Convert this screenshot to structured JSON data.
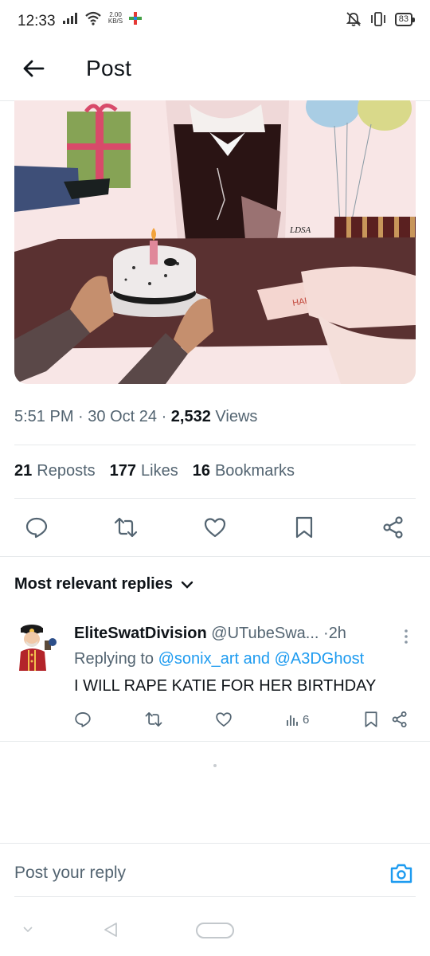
{
  "status_bar": {
    "time": "12:33",
    "speed_value": "2.00",
    "speed_unit": "KB/S",
    "battery": "83"
  },
  "header": {
    "title": "Post"
  },
  "post": {
    "image_signature": "LDSA",
    "card_text": "HAPPY BIRTHDAY",
    "time": "5:51 PM",
    "date": "30 Oct 24",
    "views_count": "2,532",
    "views_label": "Views",
    "reposts_count": "21",
    "reposts_label": "Reposts",
    "likes_count": "177",
    "likes_label": "Likes",
    "bookmarks_count": "16",
    "bookmarks_label": "Bookmarks"
  },
  "replies_section": {
    "label": "Most relevant replies"
  },
  "reply": {
    "display_name": "EliteSwatDivision",
    "handle": "@UTubeSwa...",
    "age": "2h",
    "replying_to_label": "Replying to",
    "mention_1": "@sonix_art",
    "and_label": "and",
    "mention_2": "@A3DGhost",
    "text": "I WILL RAPE KATIE FOR HER BIRTHDAY",
    "views": "6"
  },
  "composer": {
    "placeholder": "Post your reply"
  },
  "colors": {
    "accent": "#1d9bf0",
    "secondary_text": "#536471",
    "primary_text": "#0f1419",
    "table": "#5a3131",
    "wall": "#f8e6e6"
  }
}
